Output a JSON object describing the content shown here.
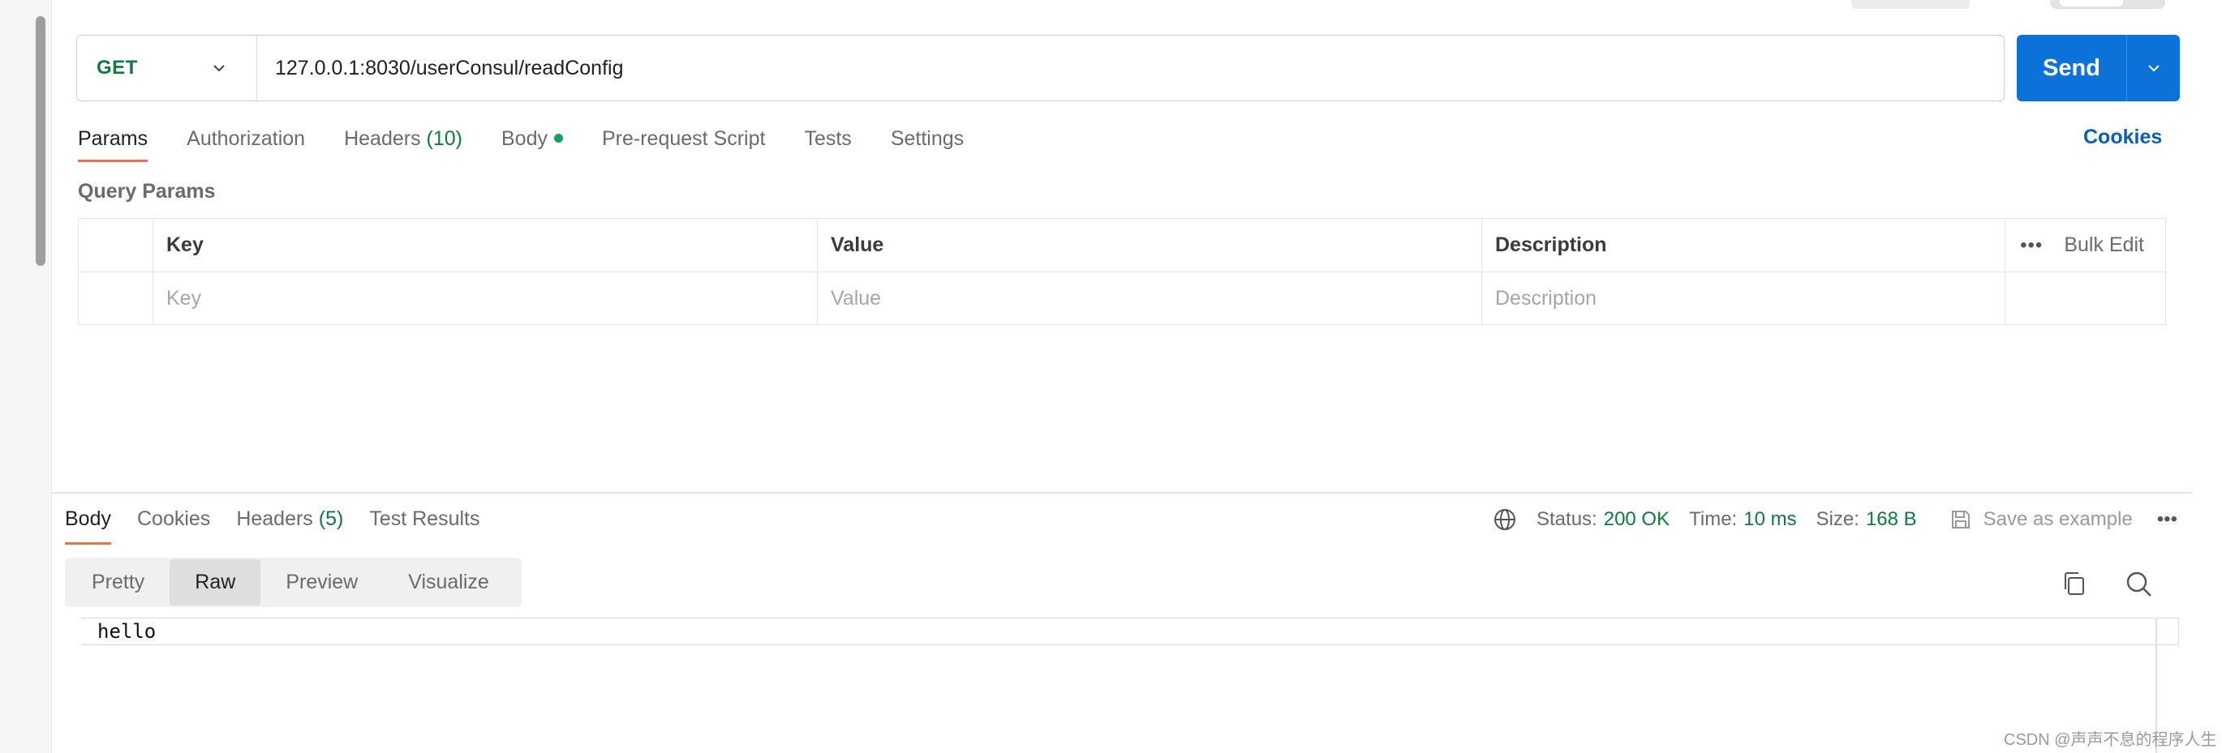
{
  "request": {
    "method": "GET",
    "url": "127.0.0.1:8030/userConsul/readConfig",
    "send_label": "Send"
  },
  "request_tabs": [
    {
      "label": "Params"
    },
    {
      "label": "Authorization"
    },
    {
      "label": "Headers",
      "count": "(10)"
    },
    {
      "label": "Body"
    },
    {
      "label": "Pre-request Script"
    },
    {
      "label": "Tests"
    },
    {
      "label": "Settings"
    }
  ],
  "cookies_link": "Cookies",
  "query_params": {
    "title": "Query Params",
    "headers": [
      "Key",
      "Value",
      "Description"
    ],
    "bulk_edit": "Bulk Edit",
    "more": "•••",
    "placeholders": [
      "Key",
      "Value",
      "Description"
    ]
  },
  "response_tabs": [
    {
      "label": "Body"
    },
    {
      "label": "Cookies"
    },
    {
      "label": "Headers",
      "count": "(5)"
    },
    {
      "label": "Test Results"
    }
  ],
  "response_status": {
    "status_label": "Status:",
    "status_value": "200 OK",
    "time_label": "Time:",
    "time_value": "10 ms",
    "size_label": "Size:",
    "size_value": "168 B",
    "save_example": "Save as example",
    "more": "•••"
  },
  "view_modes": [
    "Pretty",
    "Raw",
    "Preview",
    "Visualize"
  ],
  "response_body": "hello",
  "watermark": "CSDN @声声不息的程序人生",
  "colors": {
    "accent_blue": "#0b72d9",
    "method_green": "#0f7b3c",
    "tab_underline": "#e8724a"
  }
}
